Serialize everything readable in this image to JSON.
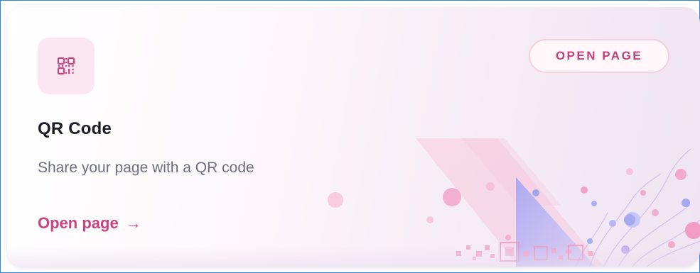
{
  "card": {
    "title": "QR Code",
    "description": "Share your page with a QR code",
    "link_label": "Open page",
    "link_arrow": "→",
    "pill_label": "OPEN PAGE",
    "icon": "qr-code-icon"
  },
  "colors": {
    "accent": "#c8447f",
    "icon_bg": "#fce6f1",
    "title": "#1c1c28",
    "description": "#6c6f80",
    "frame_border": "#2f86d4"
  }
}
